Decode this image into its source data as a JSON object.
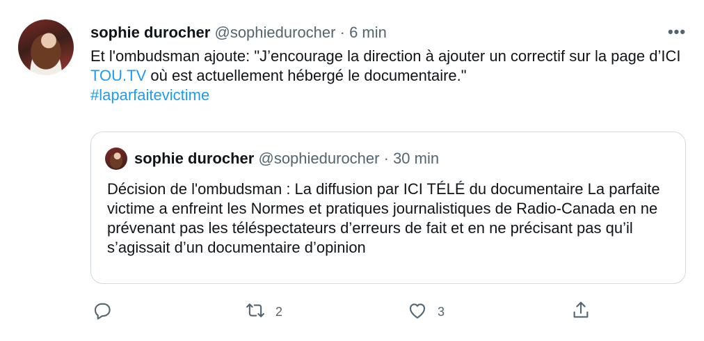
{
  "tweet": {
    "author_name": "sophie durocher",
    "author_handle": "@sophiedurocher",
    "separator": "·",
    "time": "6 min",
    "more_label": "•••",
    "text_part1": "Et l'ombudsman ajoute: \"J’encourage la direction à ajouter un correctif sur la page d’ICI ",
    "link_text": "TOU.TV",
    "text_part2": " où est actuellement hébergé le documentaire.\"",
    "hashtag": "#laparfaitevictime"
  },
  "quoted": {
    "author_name": "sophie durocher",
    "author_handle": "@sophiedurocher",
    "separator": "·",
    "time": "30 min",
    "text": "Décision de l'ombudsman : La diffusion par ICI TÉLÉ du documentaire La parfaite victime a enfreint les Normes et pratiques journalistiques de Radio-Canada en ne prévenant pas les téléspectateurs d’erreurs de fait et en ne précisant pas qu’il s’agissait d’un documentaire d’opinion"
  },
  "actions": {
    "reply_icon": "reply-icon",
    "retweet_icon": "retweet-icon",
    "retweet_count": "2",
    "like_icon": "heart-icon",
    "like_count": "3",
    "share_icon": "share-icon"
  },
  "colors": {
    "text": "#0f1419",
    "secondary": "#536471",
    "link": "#1d9bf0",
    "border": "#cfd9de"
  }
}
